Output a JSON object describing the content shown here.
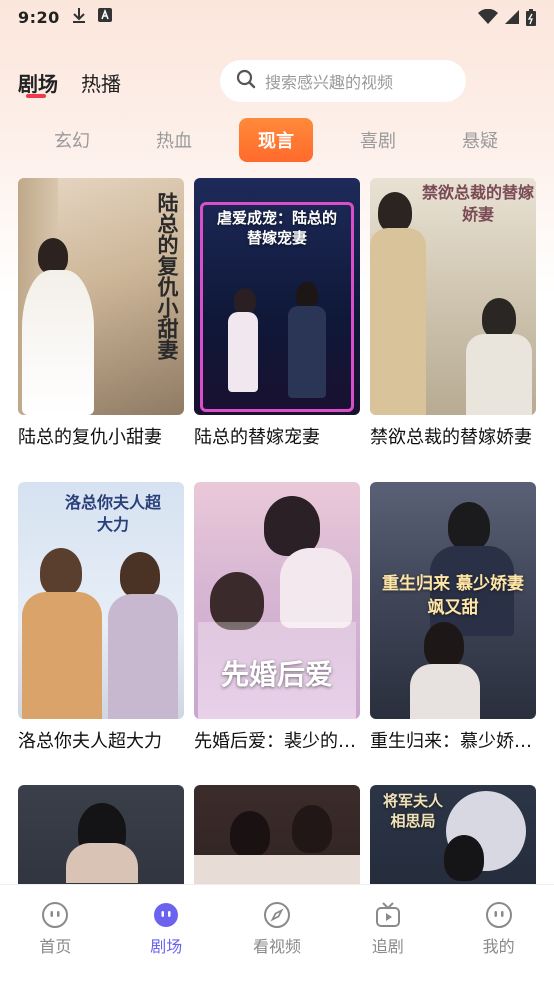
{
  "status_bar": {
    "time": "9:20",
    "download_icon": "download-icon",
    "notification_icon": "a-box-icon",
    "wifi_icon": "wifi-icon",
    "signal_icon": "signal-icon",
    "battery_icon": "battery-icon"
  },
  "header": {
    "tabs": [
      {
        "label": "剧场",
        "active": true
      },
      {
        "label": "热播",
        "active": false
      }
    ],
    "search": {
      "placeholder": "搜索感兴趣的视频",
      "icon": "search-icon"
    }
  },
  "genres": [
    {
      "label": "玄幻",
      "active": false
    },
    {
      "label": "热血",
      "active": false
    },
    {
      "label": "现言",
      "active": true
    },
    {
      "label": "喜剧",
      "active": false
    },
    {
      "label": "悬疑",
      "active": false
    }
  ],
  "colors": {
    "accent_tab_underline": "#ef3a4b",
    "genre_active": "#ff7a33",
    "nav_active": "#6b63f0"
  },
  "dramas": [
    {
      "title": "陆总的复仇小甜妻",
      "poster_text": "陆总的复仇小甜妻"
    },
    {
      "title": "陆总的替嫁宠妻",
      "poster_text": "虐爱成宠：陆总的替嫁宠妻"
    },
    {
      "title": "禁欲总裁的替嫁娇妻",
      "poster_text": "禁欲总裁的替嫁娇妻"
    },
    {
      "title": "洛总你夫人超大力",
      "poster_text": "洛总你夫人超大力"
    },
    {
      "title": "先婚后爱：裴少的小娇妻",
      "poster_text": "先婚后爱"
    },
    {
      "title": "重生归来：慕少娇妻飒又甜",
      "poster_text": "重生归来 慕少娇妻飒又甜"
    },
    {
      "title": "",
      "poster_text": ""
    },
    {
      "title": "",
      "poster_text": ""
    },
    {
      "title": "",
      "poster_text": "将军夫人 相思局"
    }
  ],
  "bottom_nav": [
    {
      "label": "首页",
      "icon": "smiley-icon",
      "active": false
    },
    {
      "label": "剧场",
      "icon": "theater-icon",
      "active": true
    },
    {
      "label": "看视频",
      "icon": "compass-icon",
      "active": false
    },
    {
      "label": "追剧",
      "icon": "tv-play-icon",
      "active": false
    },
    {
      "label": "我的",
      "icon": "profile-smiley-icon",
      "active": false
    }
  ]
}
